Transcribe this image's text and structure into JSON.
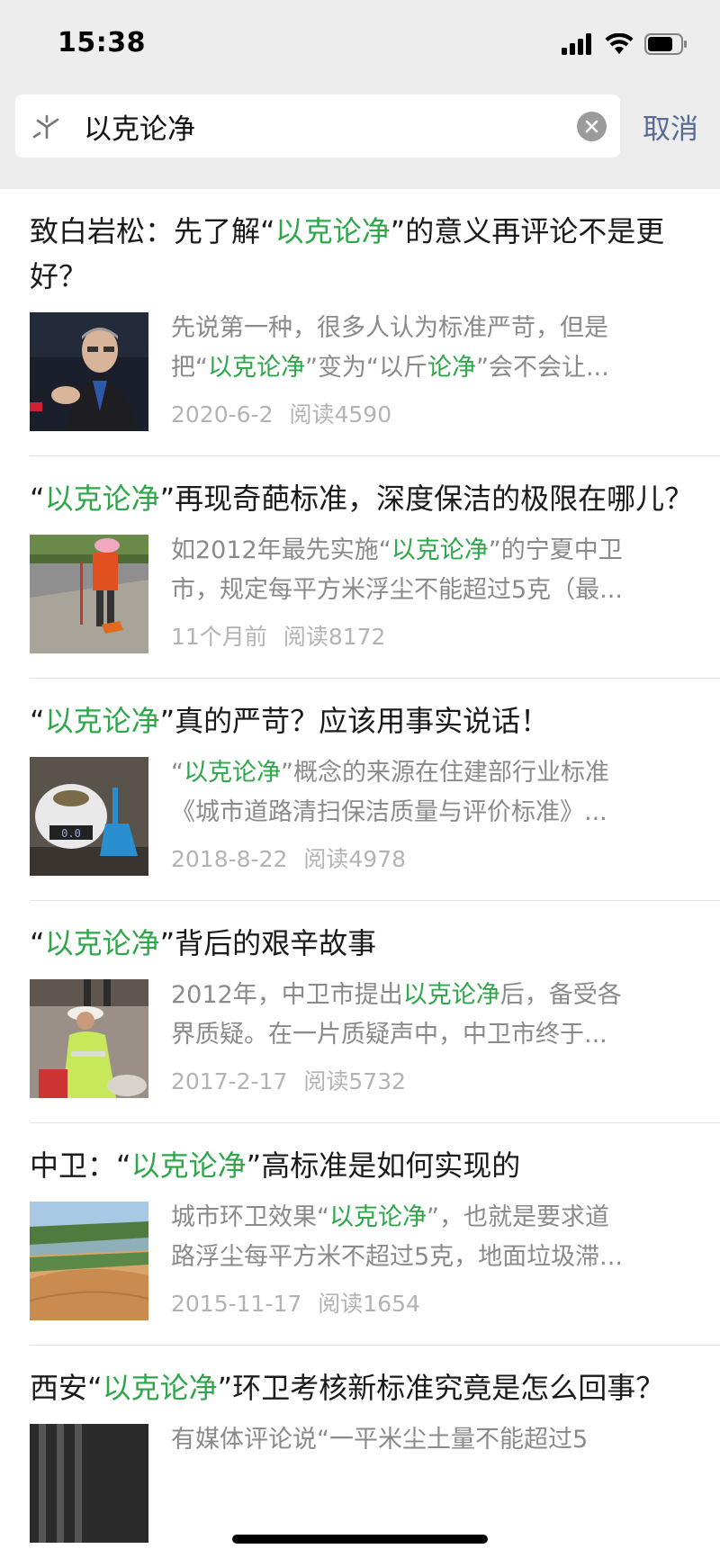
{
  "status_bar": {
    "time": "15:38"
  },
  "search": {
    "query": "以克论净",
    "cancel_label": "取消"
  },
  "icons": {
    "search": "wechat-search-icon",
    "clear": "clear-icon",
    "signal": "signal-icon",
    "wifi": "wifi-icon",
    "battery": "battery-icon"
  },
  "colors": {
    "highlight": "#2ea64a",
    "link": "#576b95",
    "meta": "#b3b3b3"
  },
  "results": [
    {
      "title": [
        {
          "t": "致白岩松：先了解“"
        },
        {
          "t": "以克论净",
          "hl": true
        },
        {
          "t": "”的意义再评论不是更好？"
        }
      ],
      "desc_lines": [
        [
          {
            "t": "先说第一种，很多人认为标准严苛，但是"
          }
        ],
        [
          {
            "t": "把“"
          },
          {
            "t": "以克论净",
            "hl": true
          },
          {
            "t": "”变为“以斤"
          },
          {
            "t": "论净",
            "hl": true
          },
          {
            "t": "”会不会让..."
          }
        ]
      ],
      "date": "2020-6-2",
      "reads": "阅读4590",
      "thumb": "portrait"
    },
    {
      "title": [
        {
          "t": "“"
        },
        {
          "t": "以克论净",
          "hl": true
        },
        {
          "t": "”再现奇葩标准，深度保洁的极限在哪儿？"
        }
      ],
      "desc_lines": [
        [
          {
            "t": "如2012年最先实施“"
          },
          {
            "t": "以克论净",
            "hl": true
          },
          {
            "t": "”的宁夏中卫"
          }
        ],
        [
          {
            "t": "市，规定每平方米浮尘不能超过5克（最..."
          }
        ]
      ],
      "date": "11个月前",
      "reads": "阅读8172",
      "thumb": "street"
    },
    {
      "title": [
        {
          "t": "“"
        },
        {
          "t": "以克论净",
          "hl": true
        },
        {
          "t": "”真的严苛？应该用事实说话！"
        }
      ],
      "desc_lines": [
        [
          {
            "t": "“"
          },
          {
            "t": "以克论净",
            "hl": true
          },
          {
            "t": "”概念的来源在住建部行业标准"
          }
        ],
        [
          {
            "t": "《城市道路清扫保洁质量与评价标准》..."
          }
        ]
      ],
      "date": "2018-8-22",
      "reads": "阅读4978",
      "thumb": "scale"
    },
    {
      "title": [
        {
          "t": "“"
        },
        {
          "t": "以克论净",
          "hl": true
        },
        {
          "t": "”背后的艰辛故事"
        }
      ],
      "desc_lines": [
        [
          {
            "t": "2012年，中卫市提出"
          },
          {
            "t": "以克论净",
            "hl": true
          },
          {
            "t": "后，备受各"
          }
        ],
        [
          {
            "t": "界质疑。在一片质疑声中，中卫市终于..."
          }
        ]
      ],
      "date": "2017-2-17",
      "reads": "阅读5732",
      "thumb": "worker"
    },
    {
      "title": [
        {
          "t": "中卫：“"
        },
        {
          "t": "以克论净",
          "hl": true
        },
        {
          "t": "”高标准是如何实现的"
        }
      ],
      "desc_lines": [
        [
          {
            "t": "城市环卫效果“"
          },
          {
            "t": "以克论净",
            "hl": true
          },
          {
            "t": "”，也就是要求道"
          }
        ],
        [
          {
            "t": "路浮尘每平方米不超过5克，地面垃圾滞..."
          }
        ]
      ],
      "date": "2015-11-17",
      "reads": "阅读1654",
      "thumb": "desert"
    },
    {
      "title": [
        {
          "t": "西安“"
        },
        {
          "t": "以克论净",
          "hl": true
        },
        {
          "t": "”环卫考核新标准究竟是怎么回事？"
        }
      ],
      "desc_lines": [
        [
          {
            "t": "有媒体评论说“一平米尘土量不能超过5"
          }
        ]
      ],
      "date": "",
      "reads": "",
      "thumb": "dark"
    }
  ]
}
